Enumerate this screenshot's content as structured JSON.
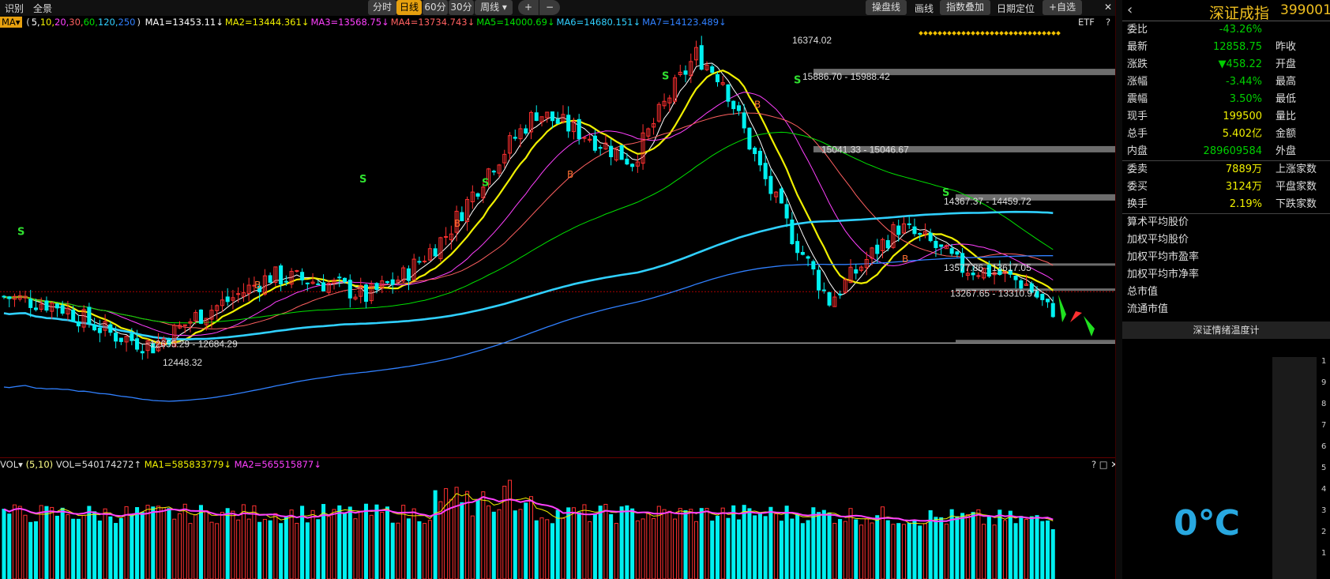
{
  "toolbar": {
    "left_items": [
      "识别",
      "全景"
    ],
    "periods": [
      "分时",
      "日线",
      "60分",
      "30分",
      "周线"
    ],
    "active_period": "日线",
    "period_dropdown": "▾",
    "zoom_in": "+",
    "zoom_out": "−",
    "right_items": [
      "操盘线",
      "画线",
      "指数叠加",
      "日期定位",
      "+自选"
    ],
    "close_glyph": "✕"
  },
  "ma_bar": {
    "selector": "MA▾",
    "params_prefix": "(",
    "params": [
      {
        "text": "5",
        "color": "#ffffff"
      },
      {
        "text": "10",
        "color": "#f0f000"
      },
      {
        "text": "20",
        "color": "#ff40ff"
      },
      {
        "text": "30",
        "color": "#ff6060"
      },
      {
        "text": "60",
        "color": "#00e000"
      },
      {
        "text": "120",
        "color": "#30d0ff"
      },
      {
        "text": "250",
        "color": "#3080ff"
      }
    ],
    "params_suffix": ")",
    "values": [
      {
        "text": "MA1=13453.11↓",
        "color": "#ffffff"
      },
      {
        "text": "MA2=13444.361↓",
        "color": "#f0f000"
      },
      {
        "text": "MA3=13568.75↓",
        "color": "#ff40ff"
      },
      {
        "text": "MA4=13734.743↓",
        "color": "#ff6060"
      },
      {
        "text": "MA5=14000.69↓",
        "color": "#00e000"
      },
      {
        "text": "MA6=14680.151↓",
        "color": "#30d0ff"
      },
      {
        "text": "MA7=14123.489↓",
        "color": "#3080ff"
      }
    ],
    "etf": "ETF",
    "help": "?"
  },
  "price_annotations": [
    "16374.02",
    "15886.70 - 15988.42",
    "15041.33 - 15046.67",
    "14367.37 - 14459.72",
    "13577.86 - 13617.05",
    "13267.65 - 13310.97",
    "12655.29 - 12684.29",
    "12448.32"
  ],
  "signals": {
    "buy": "B",
    "sell": "S"
  },
  "vol_bar": {
    "selector": "VOL▾",
    "params": "(5,10)",
    "vol": "VOL=540174272↑",
    "ma1": "MA1=585833779↓",
    "ma2": "MA2=565515877↓",
    "icons": "? □ ✕"
  },
  "sidebar": {
    "back": "‹",
    "name": "深证成指",
    "code": "399001",
    "quotes": [
      {
        "key": "委比",
        "value": "-43.26%",
        "color": "#00d000",
        "key2": ""
      },
      {
        "key": "最新",
        "value": "12858.75",
        "color": "#00d000",
        "key2": "昨收"
      },
      {
        "key": "涨跌",
        "value": "▼458.22",
        "color": "#00d000",
        "key2": "开盘"
      },
      {
        "key": "涨幅",
        "value": "-3.44%",
        "color": "#00d000",
        "key2": "最高"
      },
      {
        "key": "震幅",
        "value": "3.50%",
        "color": "#00d000",
        "key2": "最低"
      },
      {
        "key": "现手",
        "value": "199500",
        "color": "#f0f000",
        "key2": "量比"
      },
      {
        "key": "总手",
        "value": "5.402亿",
        "color": "#f0f000",
        "key2": "金额"
      },
      {
        "key": "内盘",
        "value": "289609584",
        "color": "#00d000",
        "key2": "外盘"
      }
    ],
    "quotes2": [
      {
        "key": "委卖",
        "value": "7889万",
        "color": "#f0f000",
        "key2": "上涨家数"
      },
      {
        "key": "委买",
        "value": "3124万",
        "color": "#f0f000",
        "key2": "平盘家数"
      },
      {
        "key": "换手",
        "value": "2.19%",
        "color": "#f0f000",
        "key2": "下跌家数"
      }
    ],
    "stats": [
      "算术平均股价",
      "加权平均股价",
      "加权平均市盈率",
      "加权平均市净率",
      "总市值",
      "流通市值"
    ],
    "temp_title": "深证情绪温度计",
    "temp_value": "0℃",
    "temp_ticks": [
      "1",
      "9",
      "8",
      "7",
      "6",
      "5",
      "4",
      "3",
      "2",
      "1"
    ]
  },
  "chart_data": {
    "type": "candlestick",
    "ylim": [
      11300,
      16500
    ],
    "highlight_levels": [
      15988.42,
      15046.67,
      14459.72,
      13617.05,
      13310.97,
      12684.29
    ],
    "close_trend_points": [
      [
        0,
        13250
      ],
      [
        10,
        13150
      ],
      [
        20,
        12800
      ],
      [
        28,
        12650
      ],
      [
        36,
        13000
      ],
      [
        42,
        13200
      ],
      [
        50,
        13500
      ],
      [
        57,
        13450
      ],
      [
        63,
        13380
      ],
      [
        68,
        13250
      ],
      [
        75,
        13500
      ],
      [
        83,
        14000
      ],
      [
        91,
        14800
      ],
      [
        100,
        15500
      ],
      [
        110,
        15200
      ],
      [
        118,
        14900
      ],
      [
        125,
        15700
      ],
      [
        130,
        16200
      ],
      [
        135,
        15900
      ],
      [
        142,
        14800
      ],
      [
        148,
        14000
      ],
      [
        155,
        13200
      ],
      [
        162,
        13700
      ],
      [
        168,
        14100
      ],
      [
        174,
        13900
      ],
      [
        180,
        13600
      ],
      [
        186,
        13550
      ],
      [
        192,
        13400
      ],
      [
        196,
        13100
      ]
    ],
    "candle_count": 198
  }
}
